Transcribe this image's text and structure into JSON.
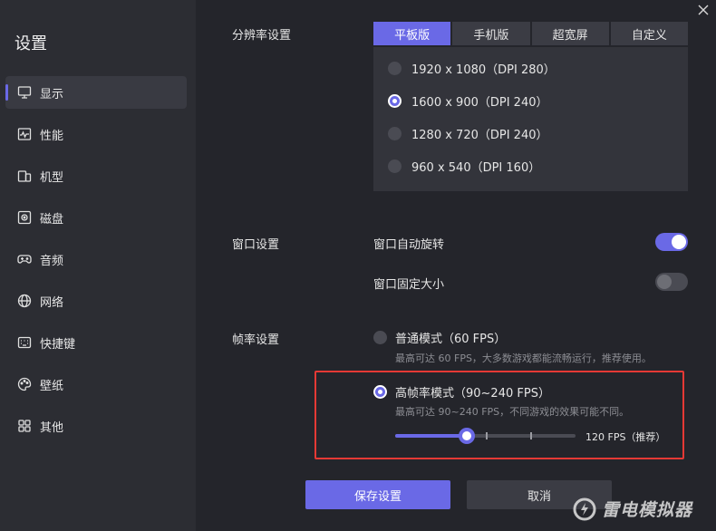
{
  "sidebar": {
    "title": "设置",
    "items": [
      {
        "label": "显示",
        "icon": "monitor-icon",
        "active": true
      },
      {
        "label": "性能",
        "icon": "performance-icon"
      },
      {
        "label": "机型",
        "icon": "device-icon"
      },
      {
        "label": "磁盘",
        "icon": "disk-icon"
      },
      {
        "label": "音频",
        "icon": "gamepad-icon"
      },
      {
        "label": "网络",
        "icon": "globe-icon"
      },
      {
        "label": "快捷键",
        "icon": "keyboard-icon"
      },
      {
        "label": "壁纸",
        "icon": "palette-icon"
      },
      {
        "label": "其他",
        "icon": "grid-icon"
      }
    ]
  },
  "resolution": {
    "label": "分辨率设置",
    "tabs": [
      "平板版",
      "手机版",
      "超宽屏",
      "自定义"
    ],
    "active_tab": "平板版",
    "options": [
      {
        "text": "1920 x 1080（DPI 280）",
        "checked": false
      },
      {
        "text": "1600 x 900（DPI 240）",
        "checked": true
      },
      {
        "text": "1280 x 720（DPI 240）",
        "checked": false
      },
      {
        "text": "960 x 540（DPI 160）",
        "checked": false
      }
    ]
  },
  "window": {
    "label": "窗口设置",
    "auto_rotate": {
      "label": "窗口自动旋转",
      "on": true
    },
    "fixed_size": {
      "label": "窗口固定大小",
      "on": false
    }
  },
  "framerate": {
    "label": "帧率设置",
    "normal": {
      "title": "普通模式（60 FPS）",
      "desc": "最高可达 60 FPS，大多数游戏都能流畅运行，推荐使用。",
      "checked": false
    },
    "high": {
      "title": "高帧率模式（90~240 FPS）",
      "desc": "最高可达 90~240 FPS，不同游戏的效果可能不同。",
      "checked": true
    },
    "slider": {
      "min": 90,
      "max": 240,
      "value": 120,
      "value_label": "120 FPS（推荐）"
    }
  },
  "buttons": {
    "save": "保存设置",
    "cancel": "取消"
  },
  "watermark": "雷电模拟器",
  "colors": {
    "accent": "#6a69e6",
    "highlight": "#e53935"
  }
}
